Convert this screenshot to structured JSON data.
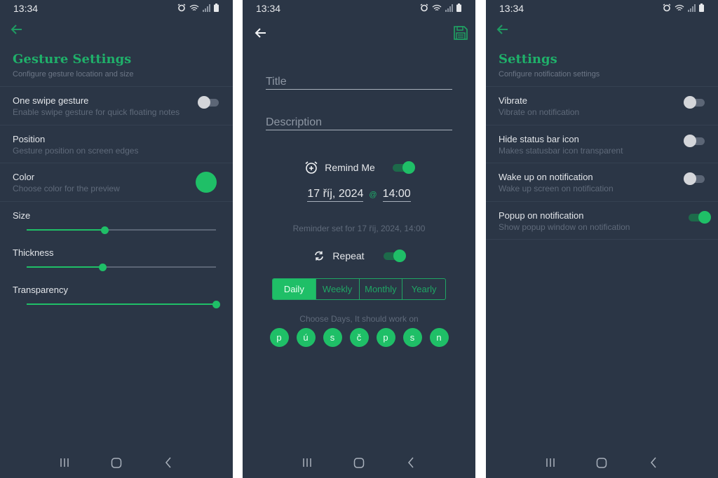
{
  "colors": {
    "background": "#2b3646",
    "accent": "#1fbf67",
    "accent_text": "#1fb06a",
    "muted_text": "#5f6a7a",
    "divider": "#354152"
  },
  "status_bar": {
    "time": "13:34",
    "icons": [
      "alarm-icon",
      "wifi-icon",
      "signal-icon",
      "battery-icon"
    ]
  },
  "nav_bar": {
    "buttons": [
      "recent-apps",
      "home",
      "back"
    ]
  },
  "screen_gesture": {
    "title": "Gesture Settings",
    "subtitle": "Configure gesture location and size",
    "preferences": [
      {
        "title": "One swipe gesture",
        "summary": "Enable swipe gesture for quick floating notes",
        "control": "switch",
        "checked": false
      },
      {
        "title": "Position",
        "summary": "Gesture position on screen edges",
        "control": "none"
      },
      {
        "title": "Color",
        "summary": "Choose color for the preview",
        "control": "color",
        "color": "#1fbf67"
      }
    ],
    "sliders": [
      {
        "label": "Size",
        "value_percent": 41
      },
      {
        "label": "Thickness",
        "value_percent": 40
      },
      {
        "label": "Transparency",
        "value_percent": 100
      }
    ]
  },
  "screen_reminder": {
    "title_placeholder": "Title",
    "description_placeholder": "Description",
    "remind_me": {
      "label": "Remind Me",
      "checked": true
    },
    "date": "17 říj, 2024",
    "at": "@",
    "time": "14:00",
    "reminder_note": "Reminder set for 17 říj, 2024, 14:00",
    "repeat": {
      "label": "Repeat",
      "checked": true
    },
    "frequency": {
      "options": [
        "Daily",
        "Weekly",
        "Monthly",
        "Yearly"
      ],
      "selected": "Daily"
    },
    "days_label": "Choose Days, It should work on",
    "days": [
      "p",
      "ú",
      "s",
      "č",
      "p",
      "s",
      "n"
    ]
  },
  "screen_notifications": {
    "title": "Settings",
    "subtitle": "Configure notification settings",
    "preferences": [
      {
        "title": "Vibrate",
        "summary": "Vibrate on notification",
        "checked": false
      },
      {
        "title": "Hide status bar icon",
        "summary": "Makes statusbar icon transparent",
        "checked": false
      },
      {
        "title": "Wake up on notification",
        "summary": "Wake up screen on notification",
        "checked": false
      },
      {
        "title": "Popup on notification",
        "summary": "Show popup window on notification",
        "checked": true
      }
    ]
  }
}
